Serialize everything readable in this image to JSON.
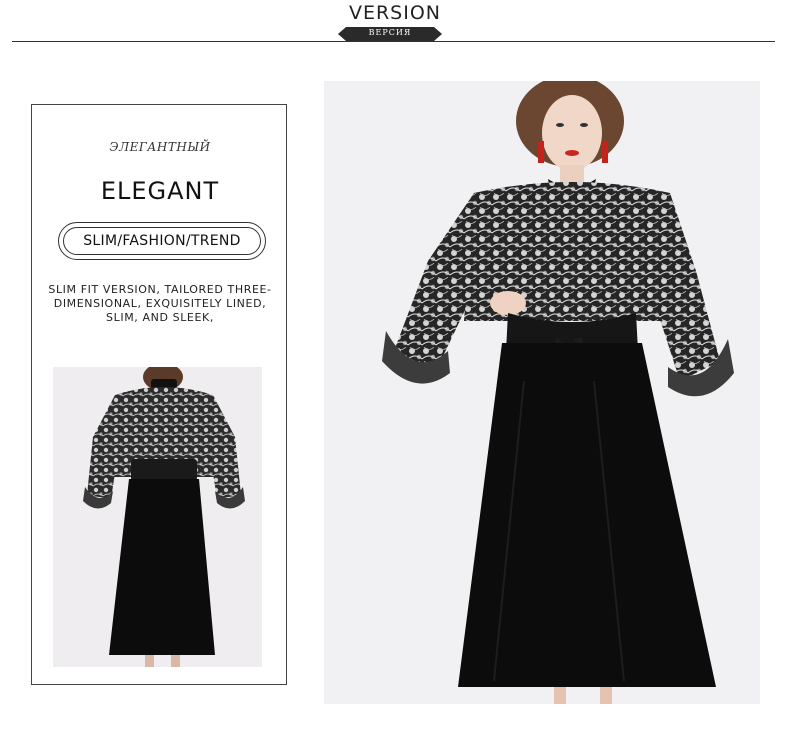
{
  "header": {
    "title": "VERSION",
    "badge_text": "ВЕРСИЯ"
  },
  "info_card": {
    "subtitle": "ЭЛЕГАНТНЫЙ",
    "title": "ELEGANT",
    "tag": "SLIM/FASHION/TREND",
    "description": "SLIM FIT VERSION, TAILORED THREE-DIMENSIONAL, EXQUISITELY LINED, SLIM, AND SLEEK,"
  },
  "colors": {
    "background": "#ffffff",
    "text": "#1a1a1a",
    "badge": "#2a2a2a",
    "dress_black": "#0c0c0c",
    "photo_bg": "#f1f0f2"
  }
}
